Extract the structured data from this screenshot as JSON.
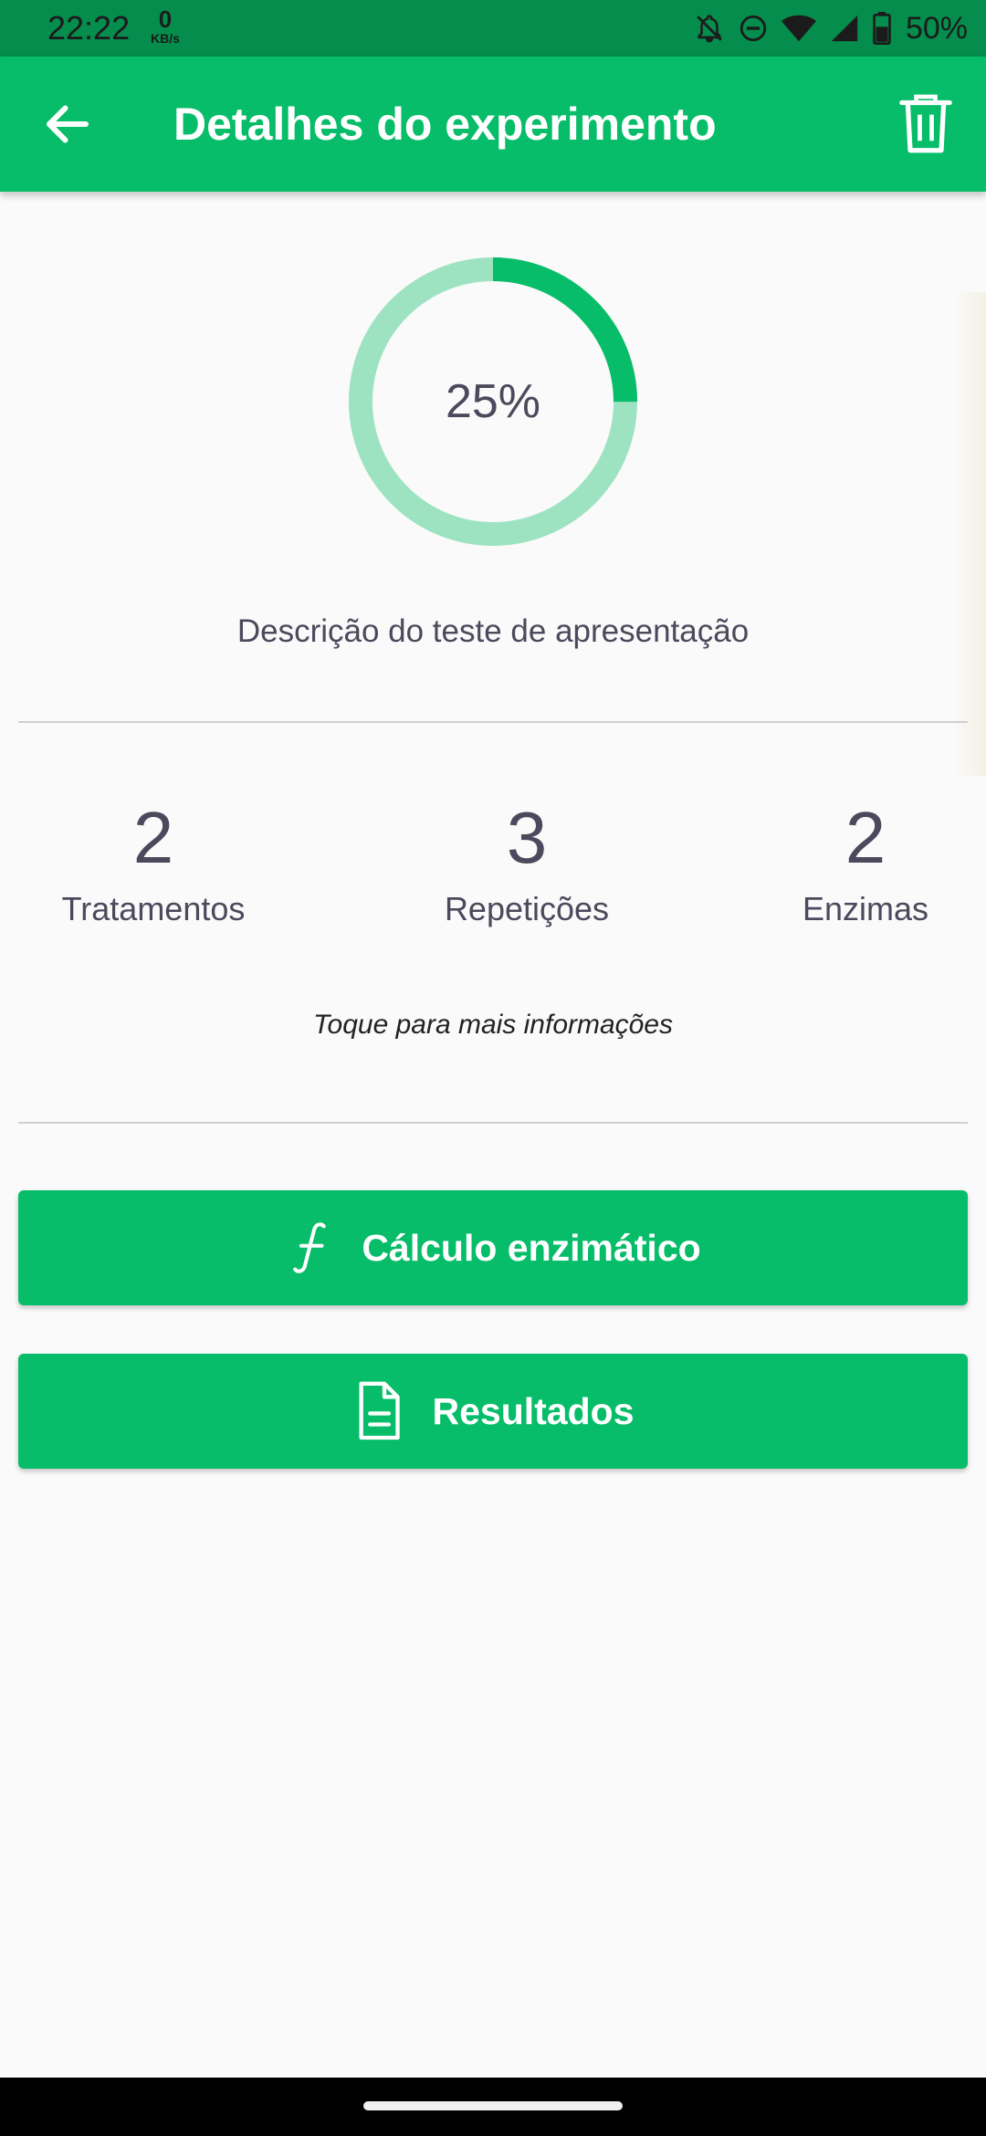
{
  "status_bar": {
    "time": "22:22",
    "net_speed_value": "0",
    "net_speed_unit": "KB/s",
    "battery_percent": "50%",
    "icons": [
      "notifications-off-icon",
      "do-not-disturb-icon",
      "wifi-icon",
      "signal-icon",
      "battery-icon"
    ]
  },
  "app_bar": {
    "title": "Detalhes do experimento",
    "back_icon": "arrow-left-icon",
    "delete_icon": "trash-icon"
  },
  "progress": {
    "label": "25%",
    "value": 0.25
  },
  "description": "Descrição do teste de apresentação",
  "stats": [
    {
      "value": "2",
      "label": "Tratamentos"
    },
    {
      "value": "3",
      "label": "Repetições"
    },
    {
      "value": "2",
      "label": "Enzimas"
    }
  ],
  "hint": "Toque para mais informações",
  "buttons": {
    "calc": {
      "label": "Cálculo enzimático",
      "icon": "function-icon"
    },
    "results": {
      "label": "Resultados",
      "icon": "document-icon"
    }
  },
  "colors": {
    "primary": "#07bd69",
    "primary_dark": "#048d4c",
    "progress_track": "#9de3c1",
    "text": "#4a4a5c"
  }
}
